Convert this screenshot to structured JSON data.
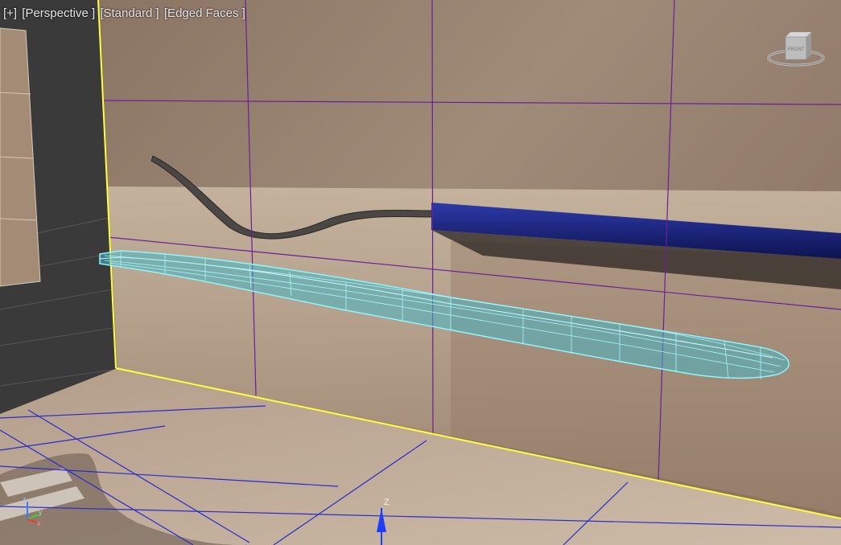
{
  "viewport": {
    "labels": {
      "plus": "[+]",
      "view": "[Perspective ]",
      "shading": "[Standard ]",
      "mode": "[Edged Faces ]"
    },
    "viewcube_face": "FRONT",
    "gizmo_axis": "Z",
    "tripod": {
      "z": "z",
      "y": "y",
      "x": "x"
    }
  },
  "colors": {
    "selection_cyan": "#8ff4ff",
    "active_frame_yellow": "#ffff3c",
    "grid_purple": "#6a1f9a",
    "floor_grid_blue": "#2a2ad0",
    "gizmo_blue": "#1f3cff"
  }
}
